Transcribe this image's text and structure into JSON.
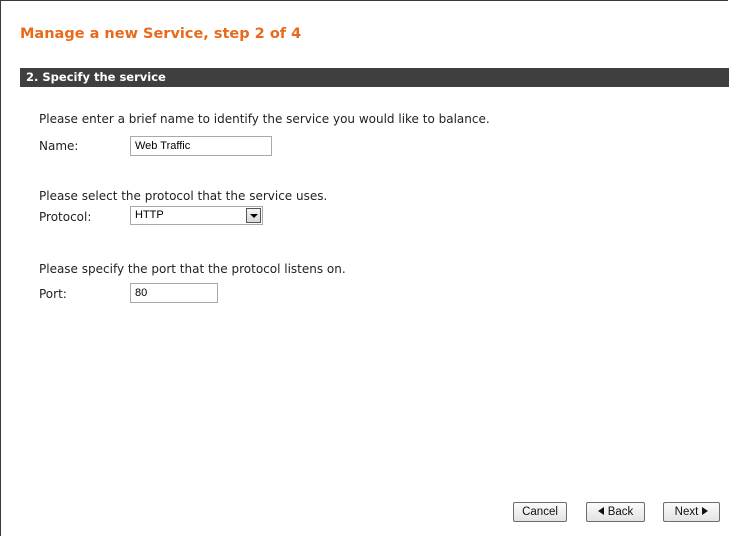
{
  "wizard": {
    "title": "Manage a new Service, step 2 of 4",
    "section_header": "2. Specify the service"
  },
  "name_field": {
    "prompt": "Please enter a brief name to identify the service you would like to balance.",
    "label": "Name:",
    "value": "Web Traffic"
  },
  "protocol_field": {
    "prompt": "Please select the protocol that the service uses.",
    "label": "Protocol:",
    "selected": "HTTP"
  },
  "port_field": {
    "prompt": "Please specify the port that the protocol listens on.",
    "label": "Port:",
    "value": "80"
  },
  "buttons": {
    "cancel": "Cancel",
    "back": "Back",
    "next": "Next"
  },
  "icons": {
    "back": "triangle-left-icon",
    "next": "triangle-right-icon",
    "dropdown": "chevron-down-icon"
  },
  "colors": {
    "title": "#e86a1a",
    "header_bg": "#3f3f3f"
  }
}
